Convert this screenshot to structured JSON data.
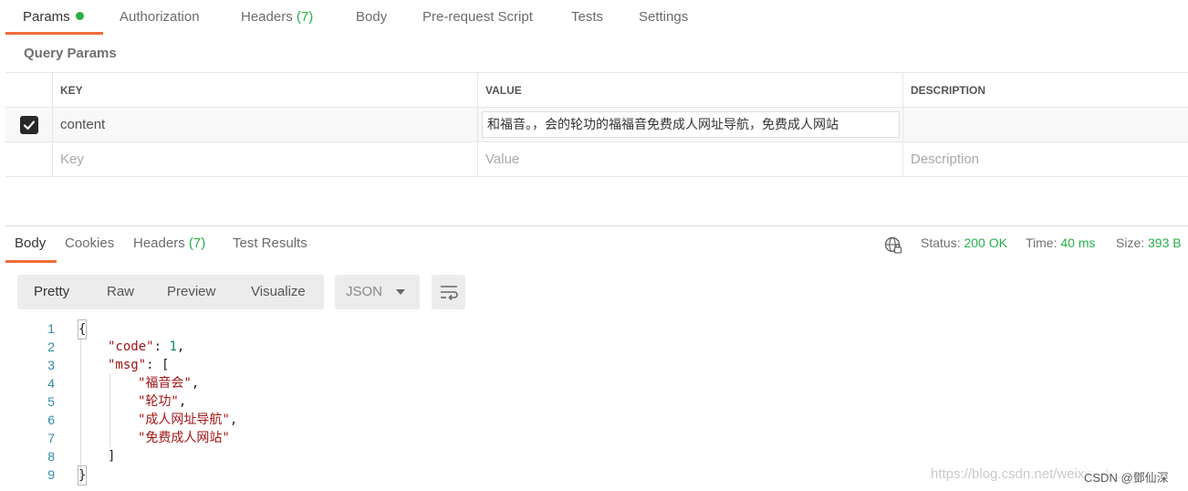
{
  "request_tabs": [
    {
      "label": "Params",
      "active": true,
      "indicator": "green-dot"
    },
    {
      "label": "Authorization"
    },
    {
      "label": "Headers",
      "count": "(7)"
    },
    {
      "label": "Body"
    },
    {
      "label": "Pre-request Script"
    },
    {
      "label": "Tests"
    },
    {
      "label": "Settings"
    }
  ],
  "query_params": {
    "title": "Query Params",
    "columns": [
      "KEY",
      "VALUE",
      "DESCRIPTION"
    ],
    "rows": [
      {
        "checked": true,
        "key": "content",
        "value": "和福音。，会的轮功的福福音免费成人网址导航，免费成人网站",
        "description": ""
      }
    ],
    "placeholder_row": {
      "key": "Key",
      "value": "Value",
      "description": "Description"
    }
  },
  "response_tabs": [
    {
      "label": "Body",
      "active": true
    },
    {
      "label": "Cookies"
    },
    {
      "label": "Headers",
      "count": "(7)"
    },
    {
      "label": "Test Results"
    }
  ],
  "response_meta": {
    "status_label": "Status:",
    "status_value": "200 OK",
    "time_label": "Time:",
    "time_value": "40 ms",
    "size_label": "Size:",
    "size_value": "393 B"
  },
  "view_modes": [
    "Pretty",
    "Raw",
    "Preview",
    "Visualize"
  ],
  "selected_view": "Pretty",
  "format": "JSON",
  "code_lines": [
    {
      "n": "1",
      "text": "{"
    },
    {
      "n": "2",
      "key": "\"code\"",
      "sep": ": ",
      "num": "1",
      "tail": ","
    },
    {
      "n": "3",
      "key": "\"msg\"",
      "sep": ": ",
      "tail": "["
    },
    {
      "n": "4",
      "str": "\"福音会\"",
      "tail": ","
    },
    {
      "n": "5",
      "str": "\"轮功\"",
      "tail": ","
    },
    {
      "n": "6",
      "str": "\"成人网址导航\"",
      "tail": ","
    },
    {
      "n": "7",
      "str": "\"免费成人网站\""
    },
    {
      "n": "8",
      "text": "]"
    },
    {
      "n": "9",
      "text": "}"
    }
  ],
  "watermark": "https://blog.csdn.net/weixin_4...",
  "credit": "CSDN @鄧仙深",
  "colors": {
    "accent": "#f26b3a",
    "success": "#26b047",
    "json_key": "#a31515",
    "json_number": "#09885a",
    "line_number": "#2f8aa8"
  }
}
